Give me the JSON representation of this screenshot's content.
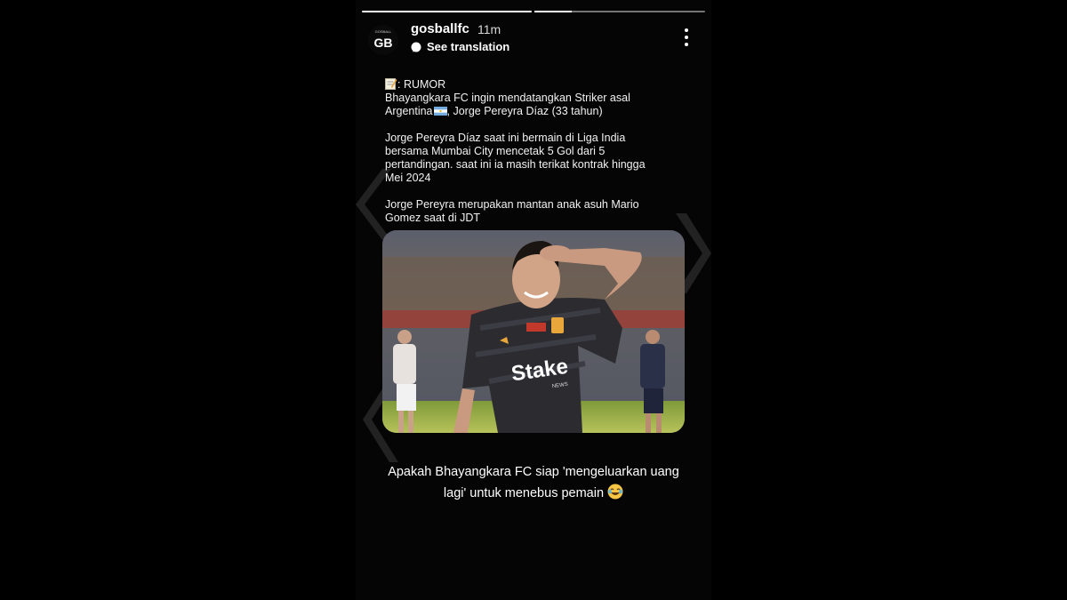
{
  "story": {
    "progress": [
      {
        "state": "complete"
      },
      {
        "state": "current",
        "fraction": 0.22
      }
    ],
    "header": {
      "username": "gosballfc",
      "time": "11m",
      "translate_label": "See translation",
      "avatar_logo": "GB",
      "avatar_small_text": "GOSBALL"
    },
    "caption": {
      "line1": ": RUMOR",
      "line2": "Bhayangkara FC ingin mendatangkan Striker asal",
      "line3a": "Argentina",
      "line3b": ", Jorge Pereyra Díaz (33 tahun)",
      "para2": [
        "Jorge Pereyra Díaz saat ini bermain di Liga India",
        "bersama Mumbai City mencetak 5 Gol dari 5",
        "pertandingan. saat ini ia masih terikat kontrak hingga",
        "Mei 2024"
      ],
      "para3": [
        "Jorge Pereyra merupakan mantan anak asuh Mario",
        "Gomez saat di JDT"
      ]
    },
    "photo": {
      "sponsor": "Stake",
      "sponsor_sub": "NEWS"
    },
    "bottom": {
      "line1": "Apakah Bhayangkara FC siap 'mengeluarkan uang",
      "line2": "lagi' untuk menebus pemain"
    },
    "icons": [
      "memo-icon",
      "argentina-flag-icon",
      "translate-icon",
      "more-options-icon",
      "laughing-emoji-icon"
    ],
    "colors": {
      "background": "#000000",
      "accent": "#ffffff"
    }
  }
}
